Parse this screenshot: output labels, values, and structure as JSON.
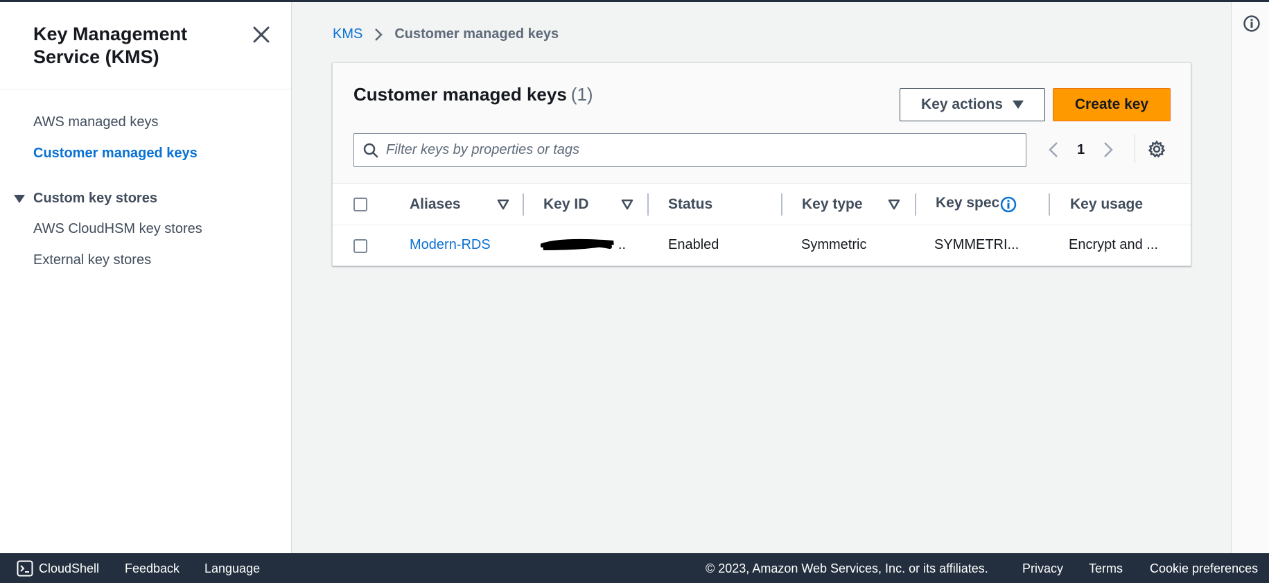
{
  "sidebar": {
    "title": "Key Management Service (KMS)",
    "items": [
      {
        "label": "AWS managed keys",
        "active": false
      },
      {
        "label": "Customer managed keys",
        "active": true
      }
    ],
    "section": {
      "label": "Custom key stores",
      "items": [
        {
          "label": "AWS CloudHSM key stores"
        },
        {
          "label": "External key stores"
        }
      ]
    }
  },
  "breadcrumb": {
    "root": "KMS",
    "current": "Customer managed keys"
  },
  "panel": {
    "title": "Customer managed keys",
    "count": "(1)",
    "key_actions_label": "Key actions",
    "create_label": "Create key",
    "filter_placeholder": "Filter keys by properties or tags",
    "page": "1"
  },
  "table": {
    "columns": [
      "Aliases",
      "Key ID",
      "Status",
      "Key type",
      "Key spec",
      "Key usage"
    ],
    "rows": [
      {
        "alias": "Modern-RDS",
        "key_id": "..",
        "status": "Enabled",
        "key_type": "Symmetric",
        "key_spec": "SYMMETRI...",
        "key_usage": "Encrypt and ..."
      }
    ]
  },
  "footer": {
    "cloudshell": "CloudShell",
    "feedback": "Feedback",
    "language": "Language",
    "copyright": "© 2023, Amazon Web Services, Inc. or its affiliates.",
    "privacy": "Privacy",
    "terms": "Terms",
    "cookies": "Cookie preferences"
  },
  "colors": {
    "link": "#0972d3",
    "primary_button": "#ff9900",
    "footer_bg": "#232f3e",
    "panel_bg": "#f2f3f3"
  },
  "icons": [
    "close-icon",
    "chevron-right-icon",
    "search-icon",
    "chevron-left-icon",
    "settings-gear-icon",
    "sort-descending-icon",
    "info-icon",
    "caret-down-icon",
    "cloudshell-icon"
  ]
}
